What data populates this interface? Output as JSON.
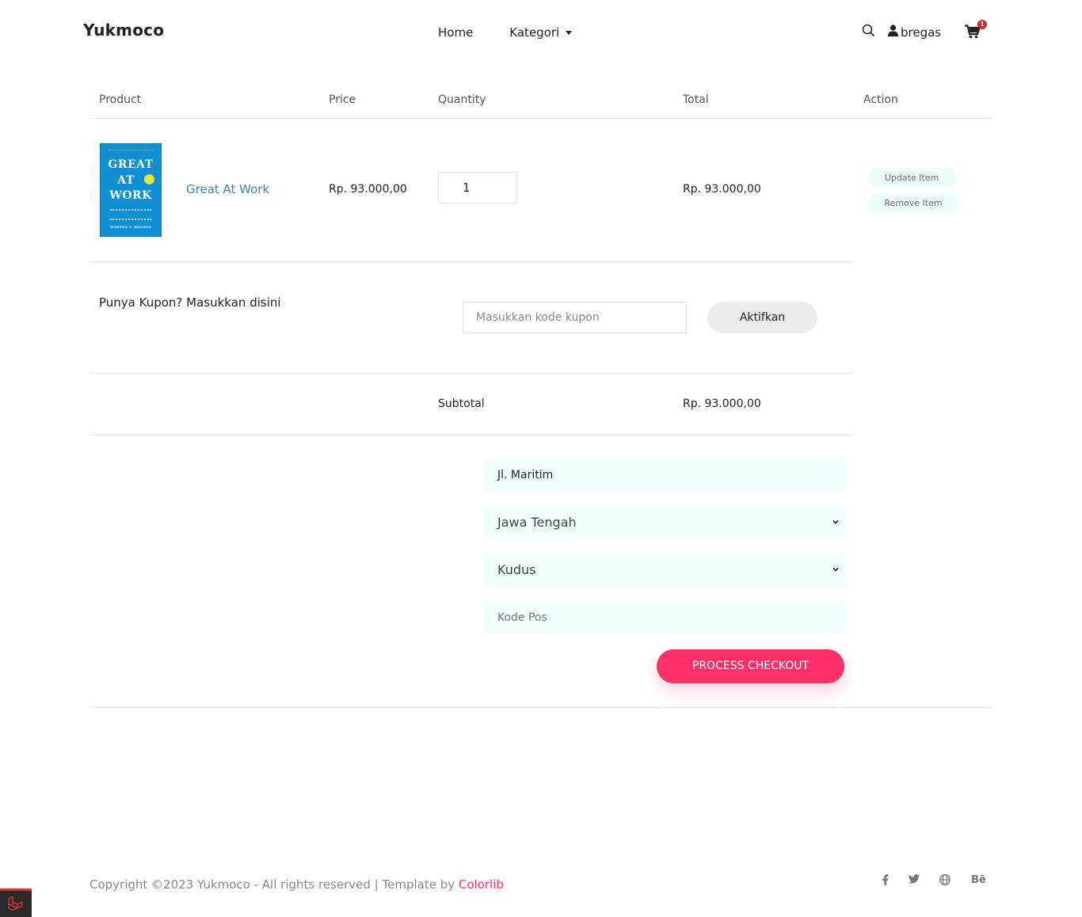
{
  "header": {
    "brand": "Yukmoco",
    "nav": {
      "home": "Home",
      "kategori": "Kategori"
    },
    "user": "bregas",
    "cart_count": "1"
  },
  "table": {
    "headers": {
      "product": "Product",
      "price": "Price",
      "quantity": "Quantity",
      "total": "Total",
      "action": "Action"
    },
    "item": {
      "cover": {
        "line1": "GREAT",
        "line2": "AT",
        "line3": "WORK",
        "author": "MORTEN T. HANSEN"
      },
      "name": "Great At Work",
      "price": "Rp. 93.000,00",
      "quantity": "1",
      "total": "Rp. 93.000,00",
      "update_label": "Update Item",
      "remove_label": "Remove Item"
    }
  },
  "coupon": {
    "label": "Punya Kupon? Masukkan disini",
    "placeholder": "Masukkan kode kupon",
    "button": "Aktifkan"
  },
  "subtotal": {
    "label": "Subtotal",
    "value": "Rp. 93.000,00"
  },
  "shipping": {
    "address": "Jl. Maritim",
    "province": "Jawa Tengah",
    "city": "Kudus",
    "postal_placeholder": "Kode Pos",
    "checkout_button": "PROCESS CHECKOUT"
  },
  "footer": {
    "copyright": "Copyright ©2023 Yukmoco - All rights reserved | Template by ",
    "template_link": "Colorlib",
    "social": {
      "behance": "Bē"
    }
  },
  "colors": {
    "accent": "#ff2f68",
    "link": "#3d7fcc",
    "field_bg": "#effdfd"
  },
  "icons": [
    "search-icon",
    "user-icon",
    "cart-icon",
    "facebook-icon",
    "twitter-icon",
    "globe-icon",
    "behance-icon",
    "laravel-icon"
  ]
}
